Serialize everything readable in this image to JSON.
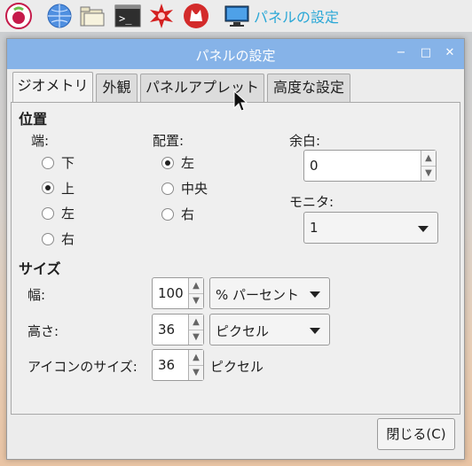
{
  "taskbar": {
    "title": "パネルの設定",
    "icons": [
      "raspberry-menu-icon",
      "web-browser-icon",
      "file-manager-icon",
      "terminal-icon",
      "mathematica-icon",
      "wolfram-icon",
      "panel-settings-icon"
    ]
  },
  "window": {
    "title": "パネルの設定",
    "buttons": [
      "minimize-icon",
      "maximize-icon",
      "close-icon"
    ]
  },
  "tabs": [
    {
      "label": "ジオメトリ",
      "active": true
    },
    {
      "label": "外観",
      "active": false
    },
    {
      "label": "パネルアプレット",
      "active": false
    },
    {
      "label": "高度な設定",
      "active": false
    }
  ],
  "position": {
    "heading": "位置",
    "edge": {
      "label": "端:",
      "options": [
        "下",
        "上",
        "左",
        "右"
      ],
      "selected": "上"
    },
    "alignment": {
      "label": "配置:",
      "options": [
        "左",
        "中央",
        "右"
      ],
      "selected": "左"
    },
    "margin": {
      "label": "余白:",
      "value": "0"
    },
    "monitor": {
      "label": "モニタ:",
      "value": "1"
    }
  },
  "size": {
    "heading": "サイズ",
    "width": {
      "label": "幅:",
      "value": "100",
      "unit": "% パーセント"
    },
    "height": {
      "label": "高さ:",
      "value": "36",
      "unit": "ピクセル"
    },
    "icon_size": {
      "label": "アイコンのサイズ:",
      "value": "36",
      "unit": "ピクセル"
    }
  },
  "footer": {
    "close_label": "閉じる(C)"
  },
  "colors": {
    "titlebar": "#86b3e8",
    "taskbar_title": "#2aa7d6"
  }
}
